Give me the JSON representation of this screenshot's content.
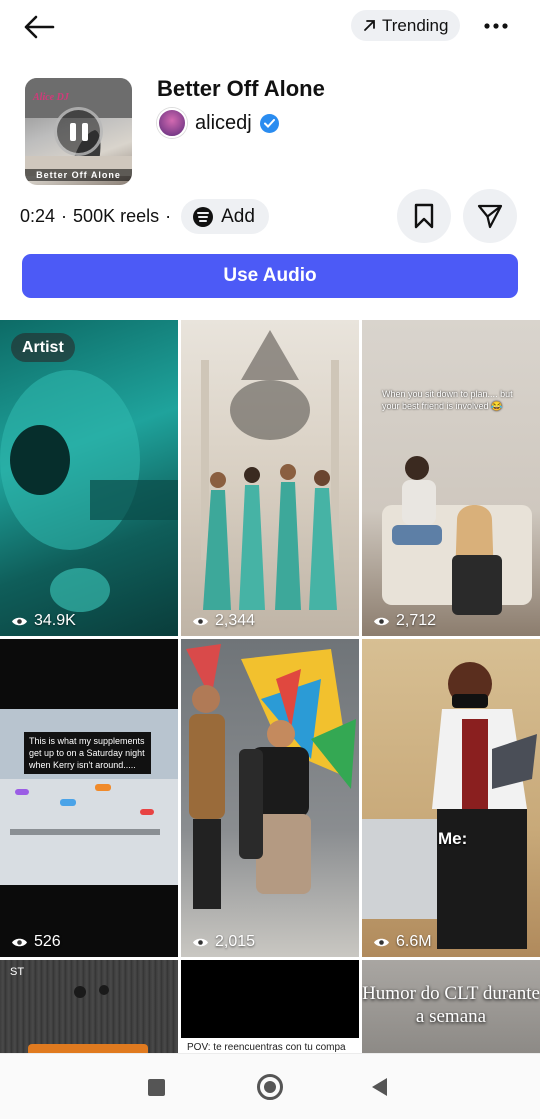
{
  "header": {
    "back_icon": "arrow-left-icon",
    "trending_label": "Trending",
    "trending_icon": "arrow-up-right-icon",
    "more_icon": "more-horizontal-icon"
  },
  "audio": {
    "title": "Better Off Alone",
    "artist": "alicedj",
    "verified": true,
    "cover_text": "Better Off Alone",
    "duration": "0:24",
    "reels_count": "500K reels",
    "separator": "·",
    "add_label": "Add",
    "add_icon": "spotify-icon",
    "save_icon": "bookmark-icon",
    "share_icon": "send-icon",
    "playback_icon": "pause-icon"
  },
  "primary_action": {
    "label": "Use Audio",
    "color": "#4c5af6"
  },
  "reels": [
    {
      "badge": "Artist",
      "views": "34.9K",
      "caption": ""
    },
    {
      "badge": "",
      "views": "2,344",
      "caption": ""
    },
    {
      "badge": "",
      "views": "2,712",
      "caption": "When you sit down to plan.... but your best friend is involved 😂"
    },
    {
      "badge": "",
      "views": "526",
      "caption": "This is what my supplements get up to on a Saturday night when Kerry isn't around....."
    },
    {
      "badge": "",
      "views": "2,015",
      "caption": ""
    },
    {
      "badge": "",
      "views": "6.6M",
      "caption": "Me:"
    },
    {
      "badge": "",
      "views": "",
      "caption": "ST"
    },
    {
      "badge": "",
      "views": "",
      "caption": "POV: te reencuentras con tu compa"
    },
    {
      "badge": "",
      "views": "",
      "caption": "Humor do CLT durante a semana"
    }
  ],
  "view_icon": "eye-icon",
  "system_nav": {
    "recents_icon": "square-icon",
    "home_icon": "circle-icon",
    "back_icon": "triangle-back-icon"
  }
}
